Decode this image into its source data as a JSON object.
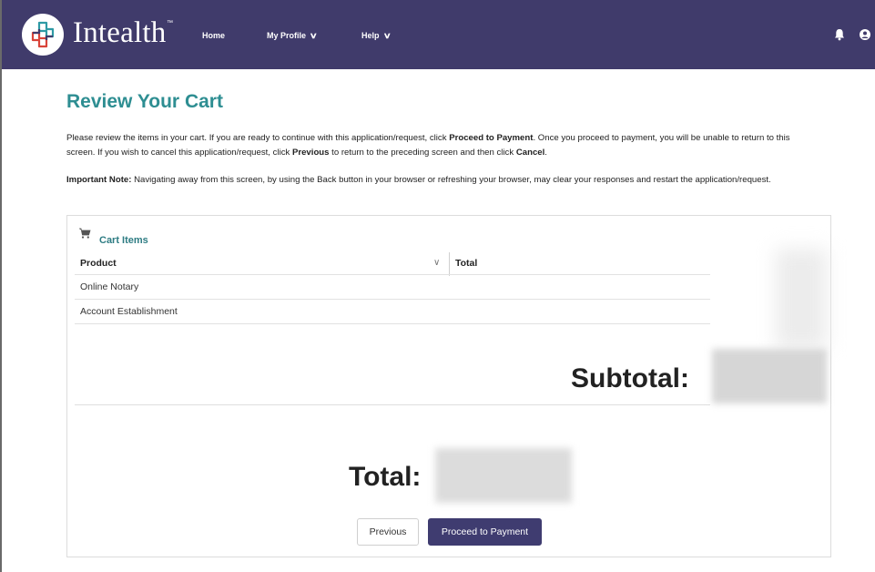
{
  "nav": {
    "brand": "Intealth",
    "brand_tm": "™",
    "links": [
      {
        "label": "Home",
        "has_chevron": false
      },
      {
        "label": "My Profile",
        "has_chevron": true
      },
      {
        "label": "Help",
        "has_chevron": true
      }
    ],
    "icons": [
      "bell-icon",
      "user-icon"
    ],
    "bg_color": "#403b6b"
  },
  "page": {
    "title": "Review Your Cart",
    "intro": {
      "t1": "Please review the items in your cart. If you are ready to continue with this application/request, click ",
      "b1": "Proceed to Payment",
      "t2": ". Once you proceed to payment, you will be unable to return to this screen. If you wish to cancel this application/request, click ",
      "b2": "Previous",
      "t3": " to return to the preceding screen and then click ",
      "b3": "Cancel",
      "t4": "."
    },
    "note": {
      "label": "Important Note:",
      "text": " Navigating away from this screen, by using the Back button in your browser or refreshing your browser, may clear your responses and restart the application/request."
    },
    "accent_color": "#2e8e92"
  },
  "cart": {
    "title": "Cart Items",
    "columns": {
      "product": "Product",
      "total": "Total"
    },
    "rows": [
      {
        "product": "Online Notary"
      },
      {
        "product": "Account Establishment"
      }
    ],
    "subtotal_label": "Subtotal:",
    "total_label": "Total:"
  },
  "actions": {
    "previous": "Previous",
    "proceed": "Proceed to Payment",
    "primary_color": "#3f3c70"
  }
}
